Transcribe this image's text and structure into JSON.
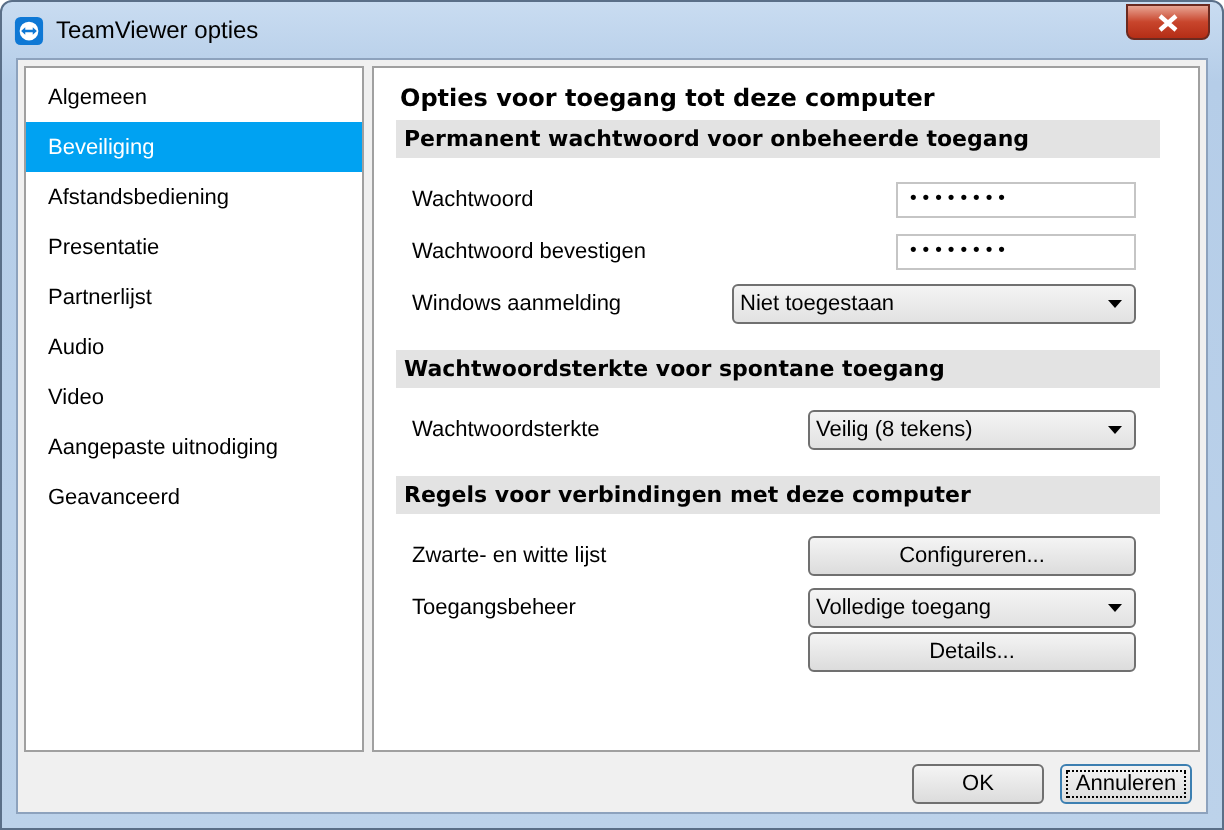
{
  "window": {
    "title": "TeamViewer opties"
  },
  "sidebar": {
    "items": [
      {
        "label": "Algemeen",
        "selected": false
      },
      {
        "label": "Beveiliging",
        "selected": true
      },
      {
        "label": "Afstandsbediening",
        "selected": false
      },
      {
        "label": "Presentatie",
        "selected": false
      },
      {
        "label": "Partnerlijst",
        "selected": false
      },
      {
        "label": "Audio",
        "selected": false
      },
      {
        "label": "Video",
        "selected": false
      },
      {
        "label": "Aangepaste uitnodiging",
        "selected": false
      },
      {
        "label": "Geavanceerd",
        "selected": false
      }
    ]
  },
  "panel": {
    "title": "Opties voor toegang tot deze computer",
    "sections": [
      {
        "heading": "Permanent wachtwoord voor onbeheerde toegang",
        "rows": [
          {
            "kind": "password",
            "label": "Wachtwoord",
            "value": "••••••••"
          },
          {
            "kind": "password",
            "label": "Wachtwoord bevestigen",
            "value": "••••••••"
          },
          {
            "kind": "select",
            "label": "Windows aanmelding",
            "value": "Niet toegestaan"
          }
        ]
      },
      {
        "heading": "Wachtwoordsterkte voor spontane toegang",
        "rows": [
          {
            "kind": "select",
            "label": "Wachtwoordsterkte",
            "value": "Veilig (8 tekens)"
          }
        ]
      },
      {
        "heading": "Regels voor verbindingen met deze computer",
        "rows": [
          {
            "kind": "button",
            "label": "Zwarte- en witte lijst",
            "value": "Configureren..."
          },
          {
            "kind": "select",
            "label": "Toegangsbeheer",
            "value": "Volledige toegang"
          },
          {
            "kind": "button",
            "value": "Details..."
          }
        ]
      }
    ]
  },
  "buttons": [
    {
      "label": "OK",
      "focused": false
    },
    {
      "label": "Annuleren",
      "focused": true
    }
  ]
}
